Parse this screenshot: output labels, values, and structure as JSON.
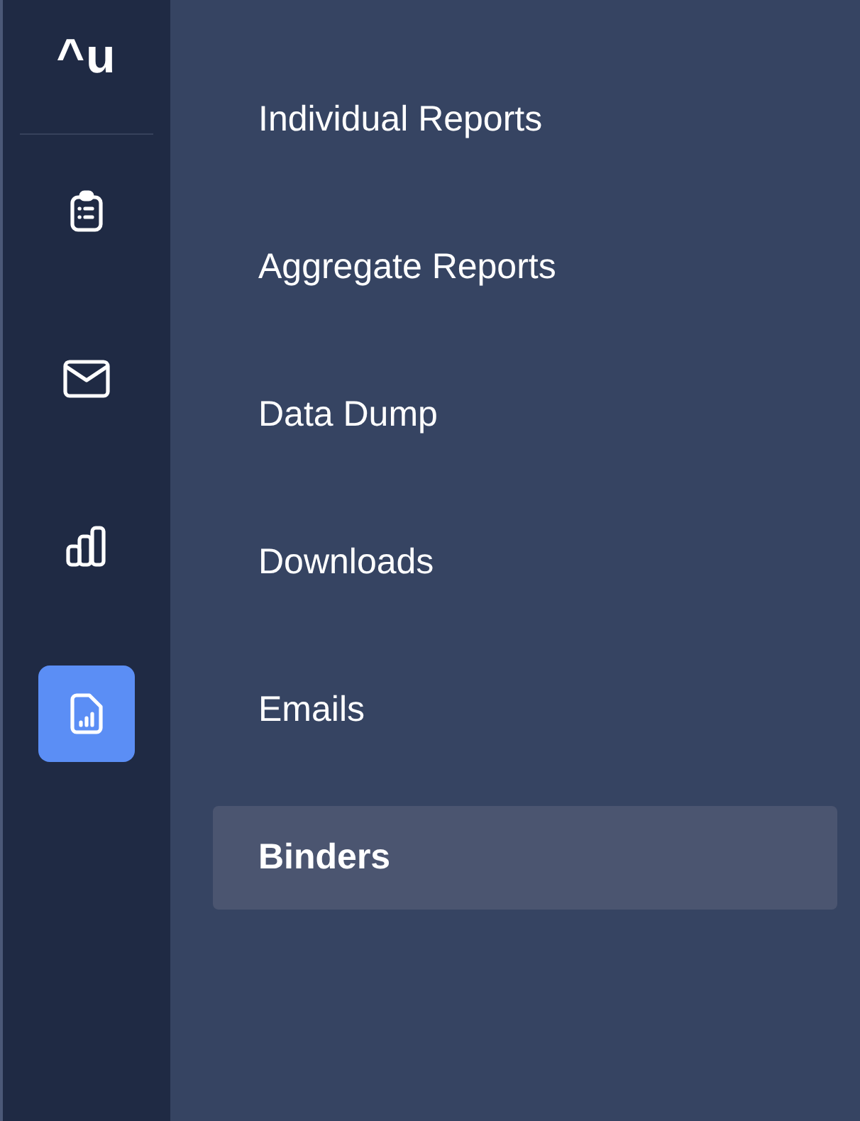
{
  "logo": "^u",
  "rail": [
    {
      "kind": "clipboard",
      "selected": false
    },
    {
      "kind": "mail",
      "selected": false
    },
    {
      "kind": "chart",
      "selected": false
    },
    {
      "kind": "report",
      "selected": true
    }
  ],
  "menu": [
    {
      "label": "Individual Reports",
      "selected": false
    },
    {
      "label": "Aggregate Reports",
      "selected": false
    },
    {
      "label": "Data Dump",
      "selected": false
    },
    {
      "label": "Downloads",
      "selected": false
    },
    {
      "label": "Emails",
      "selected": false
    },
    {
      "label": "Binders",
      "selected": true
    }
  ]
}
